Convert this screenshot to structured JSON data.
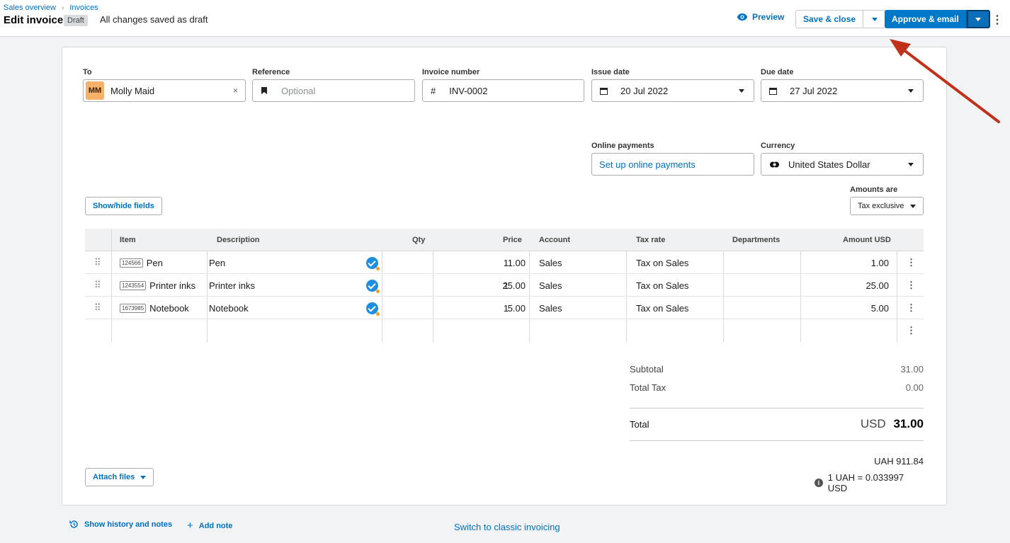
{
  "breadcrumb": {
    "items": [
      "Sales overview",
      "Invoices"
    ]
  },
  "header": {
    "title": "Edit invoice",
    "status_badge": "Draft",
    "save_status": "All changes saved as draft",
    "preview_label": "Preview",
    "save_close_label": "Save & close",
    "approve_label": "Approve & email"
  },
  "form": {
    "to": {
      "label": "To",
      "avatar_initials": "MM",
      "value": "Molly Maid"
    },
    "reference": {
      "label": "Reference",
      "placeholder": "Optional"
    },
    "invoice_number": {
      "label": "Invoice number",
      "prefix": "#",
      "value": "INV-0002"
    },
    "issue_date": {
      "label": "Issue date",
      "value": "20 Jul 2022"
    },
    "due_date": {
      "label": "Due date",
      "value": "27 Jul 2022"
    },
    "online_payments": {
      "label": "Online payments",
      "link": "Set up online payments"
    },
    "currency": {
      "label": "Currency",
      "value": "United States Dollar"
    },
    "amounts_are": {
      "label": "Amounts are",
      "value": "Tax exclusive"
    },
    "show_hide_label": "Show/hide fields"
  },
  "table": {
    "columns": [
      "Item",
      "Description",
      "Qty",
      "Price",
      "Account",
      "Tax rate",
      "Departments",
      "Amount USD"
    ],
    "rows": [
      {
        "code": "124566",
        "item": "Pen",
        "description": "Pen",
        "qty": "1",
        "price": "1.00",
        "account": "Sales",
        "tax_rate": "Tax on Sales",
        "departments": "",
        "amount": "1.00"
      },
      {
        "code": "1243554",
        "item": "Printer inks",
        "description": "Printer inks",
        "qty": "1",
        "price": "25.00",
        "account": "Sales",
        "tax_rate": "Tax on Sales",
        "departments": "",
        "amount": "25.00"
      },
      {
        "code": "1673985",
        "item": "Notebook",
        "description": "Notebook",
        "qty": "1",
        "price": "5.00",
        "account": "Sales",
        "tax_rate": "Tax on Sales",
        "departments": "",
        "amount": "5.00"
      }
    ]
  },
  "totals": {
    "subtotal_label": "Subtotal",
    "subtotal": "31.00",
    "tax_label": "Total Tax",
    "tax": "0.00",
    "total_label": "Total",
    "currency_code": "USD",
    "total": "31.00",
    "converted": "UAH 911.84",
    "rate": "1 UAH = 0.033997 USD"
  },
  "attach_label": "Attach files",
  "footer": {
    "history_label": "Show history and notes",
    "add_note_label": "Add note",
    "classic_label": "Switch to classic invoicing"
  },
  "colors": {
    "accent": "#0078c8",
    "link": "#0070c0",
    "annotation_arrow": "#c0311a"
  }
}
